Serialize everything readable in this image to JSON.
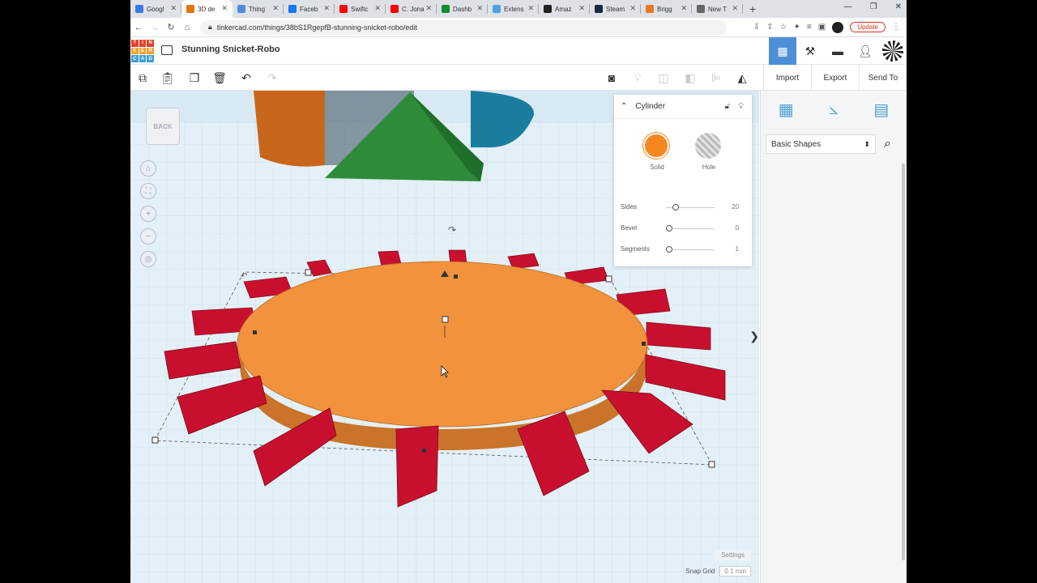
{
  "browser": {
    "tabs": [
      {
        "label": "Googl",
        "color": "#3b78e7",
        "active": false
      },
      {
        "label": "3D de",
        "color": "#e8710a",
        "active": true
      },
      {
        "label": "Thing",
        "color": "#4a90d9",
        "active": false
      },
      {
        "label": "Faceb",
        "color": "#1877f2",
        "active": false
      },
      {
        "label": "Swiftc",
        "color": "#ff0000",
        "active": false
      },
      {
        "label": "C. Jona",
        "color": "#ff0000",
        "active": false
      },
      {
        "label": "Dashb",
        "color": "#138a36",
        "active": false
      },
      {
        "label": "Extens",
        "color": "#4aa3df",
        "active": false
      },
      {
        "label": "Amaz",
        "color": "#222222",
        "active": false
      },
      {
        "label": "Steam",
        "color": "#1b2838",
        "active": false
      },
      {
        "label": "Brigg",
        "color": "#e87722",
        "active": false
      },
      {
        "label": "New T",
        "color": "#666666",
        "active": false
      }
    ],
    "url": "tinkercad.com/things/38bS1RgepfB-stunning-snicket-robo/edit",
    "update_label": "Update"
  },
  "header": {
    "logo_letters": [
      "T",
      "I",
      "N",
      "K",
      "E",
      "R",
      "C",
      "A",
      "D"
    ],
    "design_title": "Stunning Snicket-Robo"
  },
  "toolbar": {
    "import_label": "Import",
    "export_label": "Export",
    "send_to_label": "Send To"
  },
  "workplane": {
    "viewcube_label": "BACK",
    "settings_label": "Settings",
    "snap_grid_label": "Snap Grid",
    "snap_grid_value": "0.1 mm"
  },
  "inspector": {
    "title": "Cylinder",
    "solid_label": "Solid",
    "hole_label": "Hole",
    "solid_color": "#f5871f",
    "sides_label": "Sides",
    "sides_value": "20",
    "bevel_label": "Bevel",
    "bevel_value": "0",
    "segments_label": "Segments",
    "segments_value": "1"
  },
  "shapes_panel": {
    "category": "Basic Shapes",
    "shapes": [
      {
        "name": "box-hole",
        "color": "#c8c8c8"
      },
      {
        "name": "cylinder-hole",
        "color": "#c8c8c8"
      },
      {
        "name": "box",
        "color": "#d7102e"
      },
      {
        "name": "cylinder",
        "color": "#e8791e"
      },
      {
        "name": "sphere",
        "color": "#1a9fd0"
      },
      {
        "name": "scribble",
        "color": "#6ea6d8"
      },
      {
        "name": "roof",
        "color": "#3aa33a"
      },
      {
        "name": "cone",
        "color": "#8c2aa8"
      },
      {
        "name": "round-roof",
        "color": "#5fc3c7"
      },
      {
        "name": "text",
        "color": "#c8102e"
      },
      {
        "name": "wedge",
        "color": "#2a44a0"
      },
      {
        "name": "pyramid",
        "color": "#f0d21a"
      },
      {
        "name": "half-sphere",
        "color": "#d41c8c"
      },
      {
        "name": "polygon",
        "color": "#2a44a0"
      },
      {
        "name": "paraboloid",
        "color": "#d0d0d0"
      },
      {
        "name": "torus",
        "color": "#1a9fd0"
      },
      {
        "name": "tube",
        "color": "#e8791e"
      },
      {
        "name": "heart",
        "color": "#9c6b4a"
      },
      {
        "name": "star",
        "color": "#5fb8c8"
      },
      {
        "name": "star-yellow",
        "color": "#e8d81a"
      },
      {
        "name": "icosahedron",
        "color": "#d7102e"
      },
      {
        "name": "ring",
        "color": "#a07050"
      },
      {
        "name": "rounded-box",
        "color": "#d0d0d0"
      },
      {
        "name": "diamond",
        "color": "#6ec8d8"
      }
    ]
  }
}
